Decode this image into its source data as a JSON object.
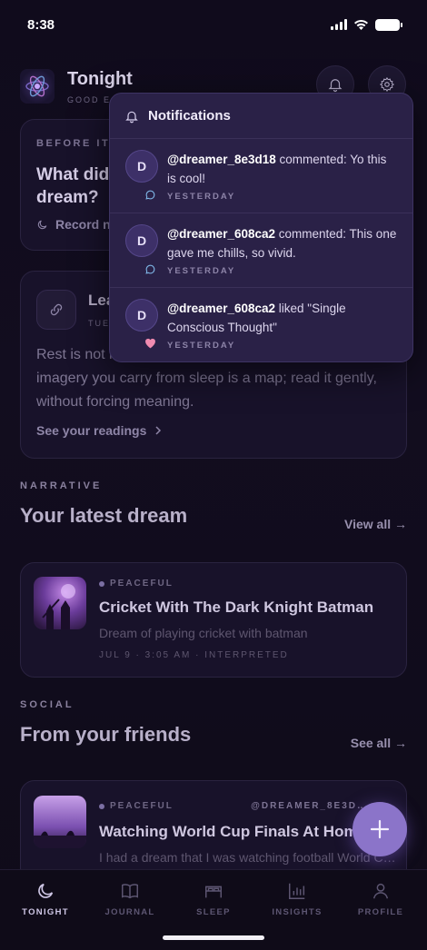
{
  "status": {
    "time": "8:38"
  },
  "header": {
    "title": "Tonight",
    "subtitle": "GOOD E"
  },
  "before_card": {
    "eyebrow": "BEFORE IT R",
    "question_line1": "What did",
    "question_line2": "dream?",
    "record_label": "Record n"
  },
  "reading_card": {
    "heading": "Lea",
    "date": "TUES",
    "text_line1": "Rest is not i",
    "text_line2": "imagery you carry from sleep is a map; read it gently,",
    "text_line3": "without forcing meaning.",
    "link": "See your readings"
  },
  "narrative": {
    "eyebrow": "NARRATIVE",
    "title": "Your latest dream",
    "view_all": "View all →"
  },
  "latest_dream": {
    "mood": "PEACEFUL",
    "title": "Cricket With The Dark Knight Batman",
    "description": "Dream of playing cricket with batman",
    "meta": "JUL 9 · 3:05 AM · INTERPRETED"
  },
  "social": {
    "eyebrow": "SOCIAL",
    "title": "From your friends",
    "see_all": "See all →"
  },
  "friend_dream": {
    "mood": "PEACEFUL",
    "user": "@DREAMER_8E3D…",
    "title": "Watching World Cup Finals At Home",
    "description": "I had a dream that I was watching football World C…"
  },
  "notifications": {
    "title": "Notifications",
    "items": [
      {
        "avatar": "D",
        "user": "@dreamer_8e3d18",
        "text": " commented: Yo this is cool!",
        "time": "YESTERDAY",
        "kind": "comment-icon"
      },
      {
        "avatar": "D",
        "user": "@dreamer_608ca2",
        "text": " commented: This one gave me chills, so vivid.",
        "time": "YESTERDAY",
        "kind": "comment-icon"
      },
      {
        "avatar": "D",
        "user": "@dreamer_608ca2",
        "text": " liked \"Single Conscious Thought\"",
        "time": "YESTERDAY",
        "kind": "heart-icon"
      }
    ]
  },
  "nav": {
    "items": [
      {
        "label": "TONIGHT",
        "icon": "moon-icon"
      },
      {
        "label": "JOURNAL",
        "icon": "book-icon"
      },
      {
        "label": "SLEEP",
        "icon": "bed-icon"
      },
      {
        "label": "INSIGHTS",
        "icon": "chart-icon"
      },
      {
        "label": "PROFILE",
        "icon": "person-icon"
      }
    ]
  },
  "colors": {
    "accent": "#8b74c9",
    "popover": "#2a2147",
    "background": "#100b1c"
  }
}
